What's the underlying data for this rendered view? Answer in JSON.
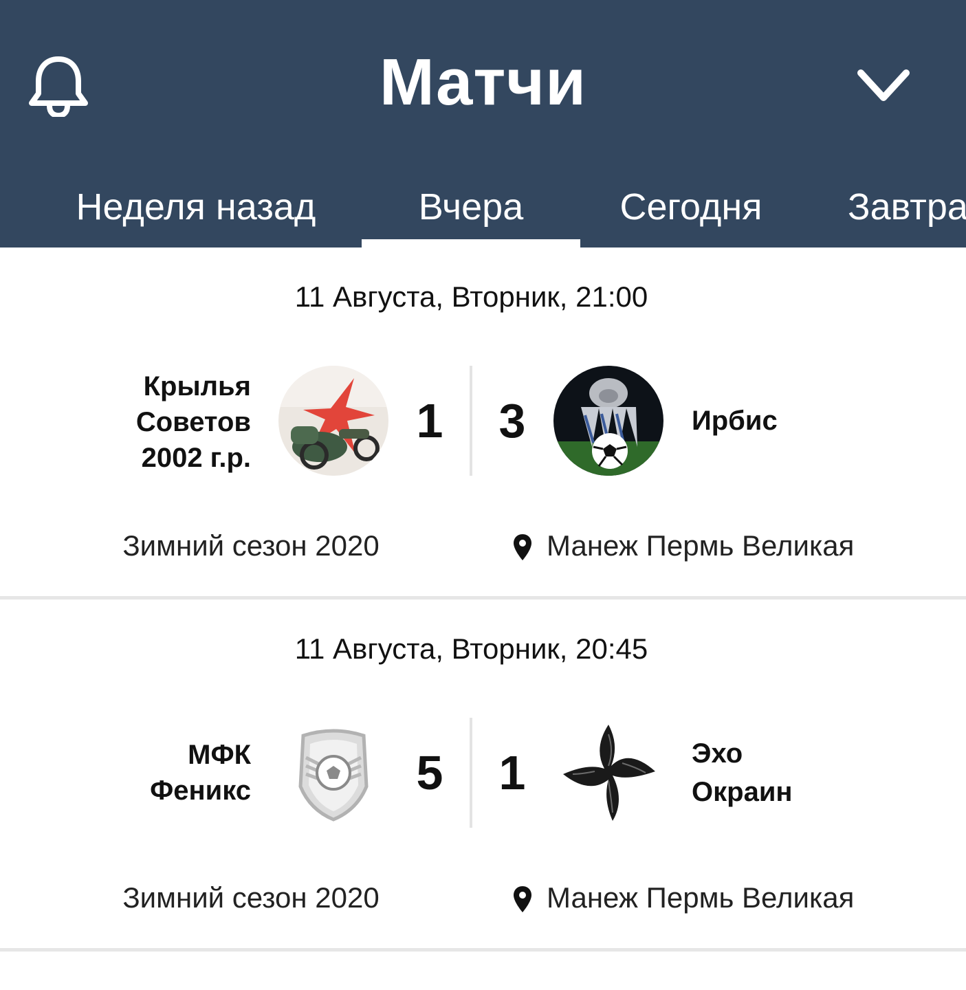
{
  "header": {
    "title": "Матчи",
    "bell_icon": "bell-icon",
    "dropdown_icon": "chevron-down-icon",
    "background": "#33475f"
  },
  "tabs": [
    {
      "label": "Неделя назад",
      "selected": false
    },
    {
      "label": "Вчера",
      "selected": true
    },
    {
      "label": "Сегодня",
      "selected": false
    },
    {
      "label": "Завтра",
      "selected": false
    }
  ],
  "matches": [
    {
      "datetime": "11 Августа, Вторник, 21:00",
      "home": {
        "name_lines": [
          "Крылья",
          "Советов",
          "2002 г.р."
        ],
        "score": "1",
        "logo": "krylya-sovetov-logo"
      },
      "away": {
        "name_lines": [
          "Ирбис"
        ],
        "score": "3",
        "logo": "irbis-logo"
      },
      "league": "Зимний сезон 2020",
      "venue": "Манеж Пермь Великая"
    },
    {
      "datetime": "11 Августа, Вторник, 20:45",
      "home": {
        "name_lines": [
          "МФК",
          "Феникс"
        ],
        "score": "5",
        "logo": "mfk-feniks-logo"
      },
      "away": {
        "name_lines": [
          "Эхо",
          "Окраин"
        ],
        "score": "1",
        "logo": "eho-okrain-logo"
      },
      "league": "Зимний сезон 2020",
      "venue": "Манеж Пермь Великая"
    }
  ]
}
